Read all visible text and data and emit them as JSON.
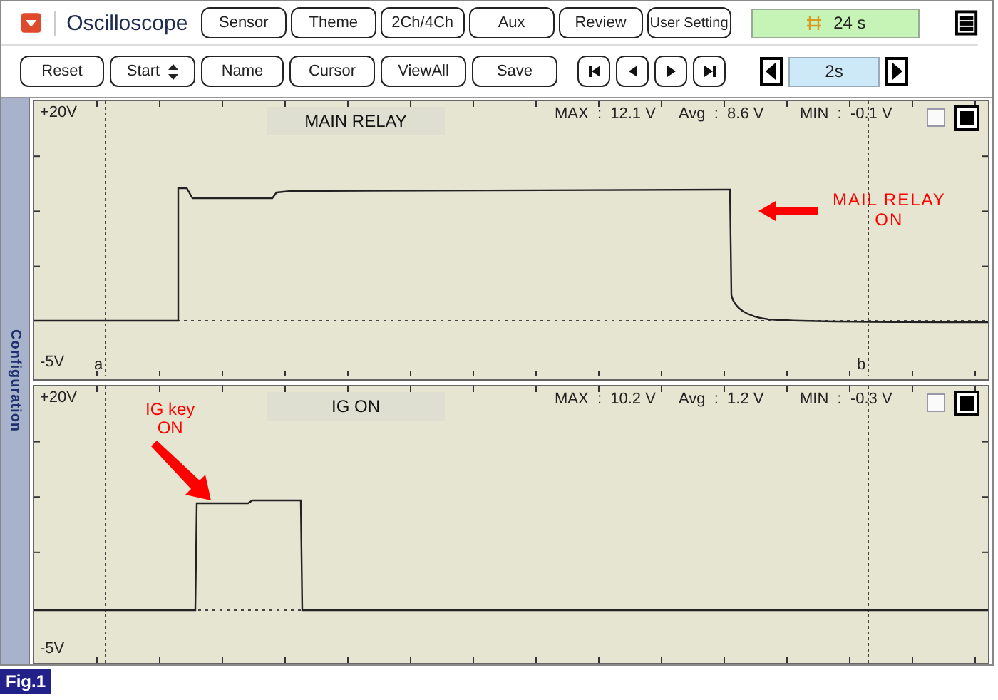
{
  "title": "Oscilloscope",
  "top_buttons": [
    "Sensor",
    "Theme",
    "2Ch/4Ch",
    "Aux",
    "Review",
    "User Setting"
  ],
  "timer": "24 s",
  "control_buttons": [
    {
      "label": "Reset",
      "kind": "button"
    },
    {
      "label": "Start",
      "kind": "spinner"
    },
    {
      "label": "Name",
      "kind": "button"
    },
    {
      "label": "Cursor",
      "kind": "button"
    },
    {
      "label": "ViewAll",
      "kind": "button"
    },
    {
      "label": "Save",
      "kind": "button"
    }
  ],
  "time_scale": "2s",
  "side_tab": "Configuration",
  "channels": [
    {
      "name": "MAIN RELAY",
      "y_top": "+20V",
      "y_bottom": "-5V",
      "max": "MAX  :  12.1 V",
      "avg": "Avg  :  8.6 V",
      "min": "MIN  :  -0.1 V",
      "checked": false,
      "kind": "relay",
      "cursor_labels": [
        "a",
        "b"
      ],
      "note": {
        "text": "MAIL RELAY\nON",
        "kind": "left-arrow"
      }
    },
    {
      "name": "IG ON",
      "y_top": "+20V",
      "y_bottom": "-5V",
      "max": "MAX  :  10.2 V",
      "avg": "Avg  :  1.2 V",
      "min": "MIN  :  -0.3 V",
      "checked": false,
      "kind": "ig",
      "note": {
        "text": "IG key\nON",
        "kind": "down-right-arrow"
      }
    }
  ],
  "figure_label": "Fig.1"
}
